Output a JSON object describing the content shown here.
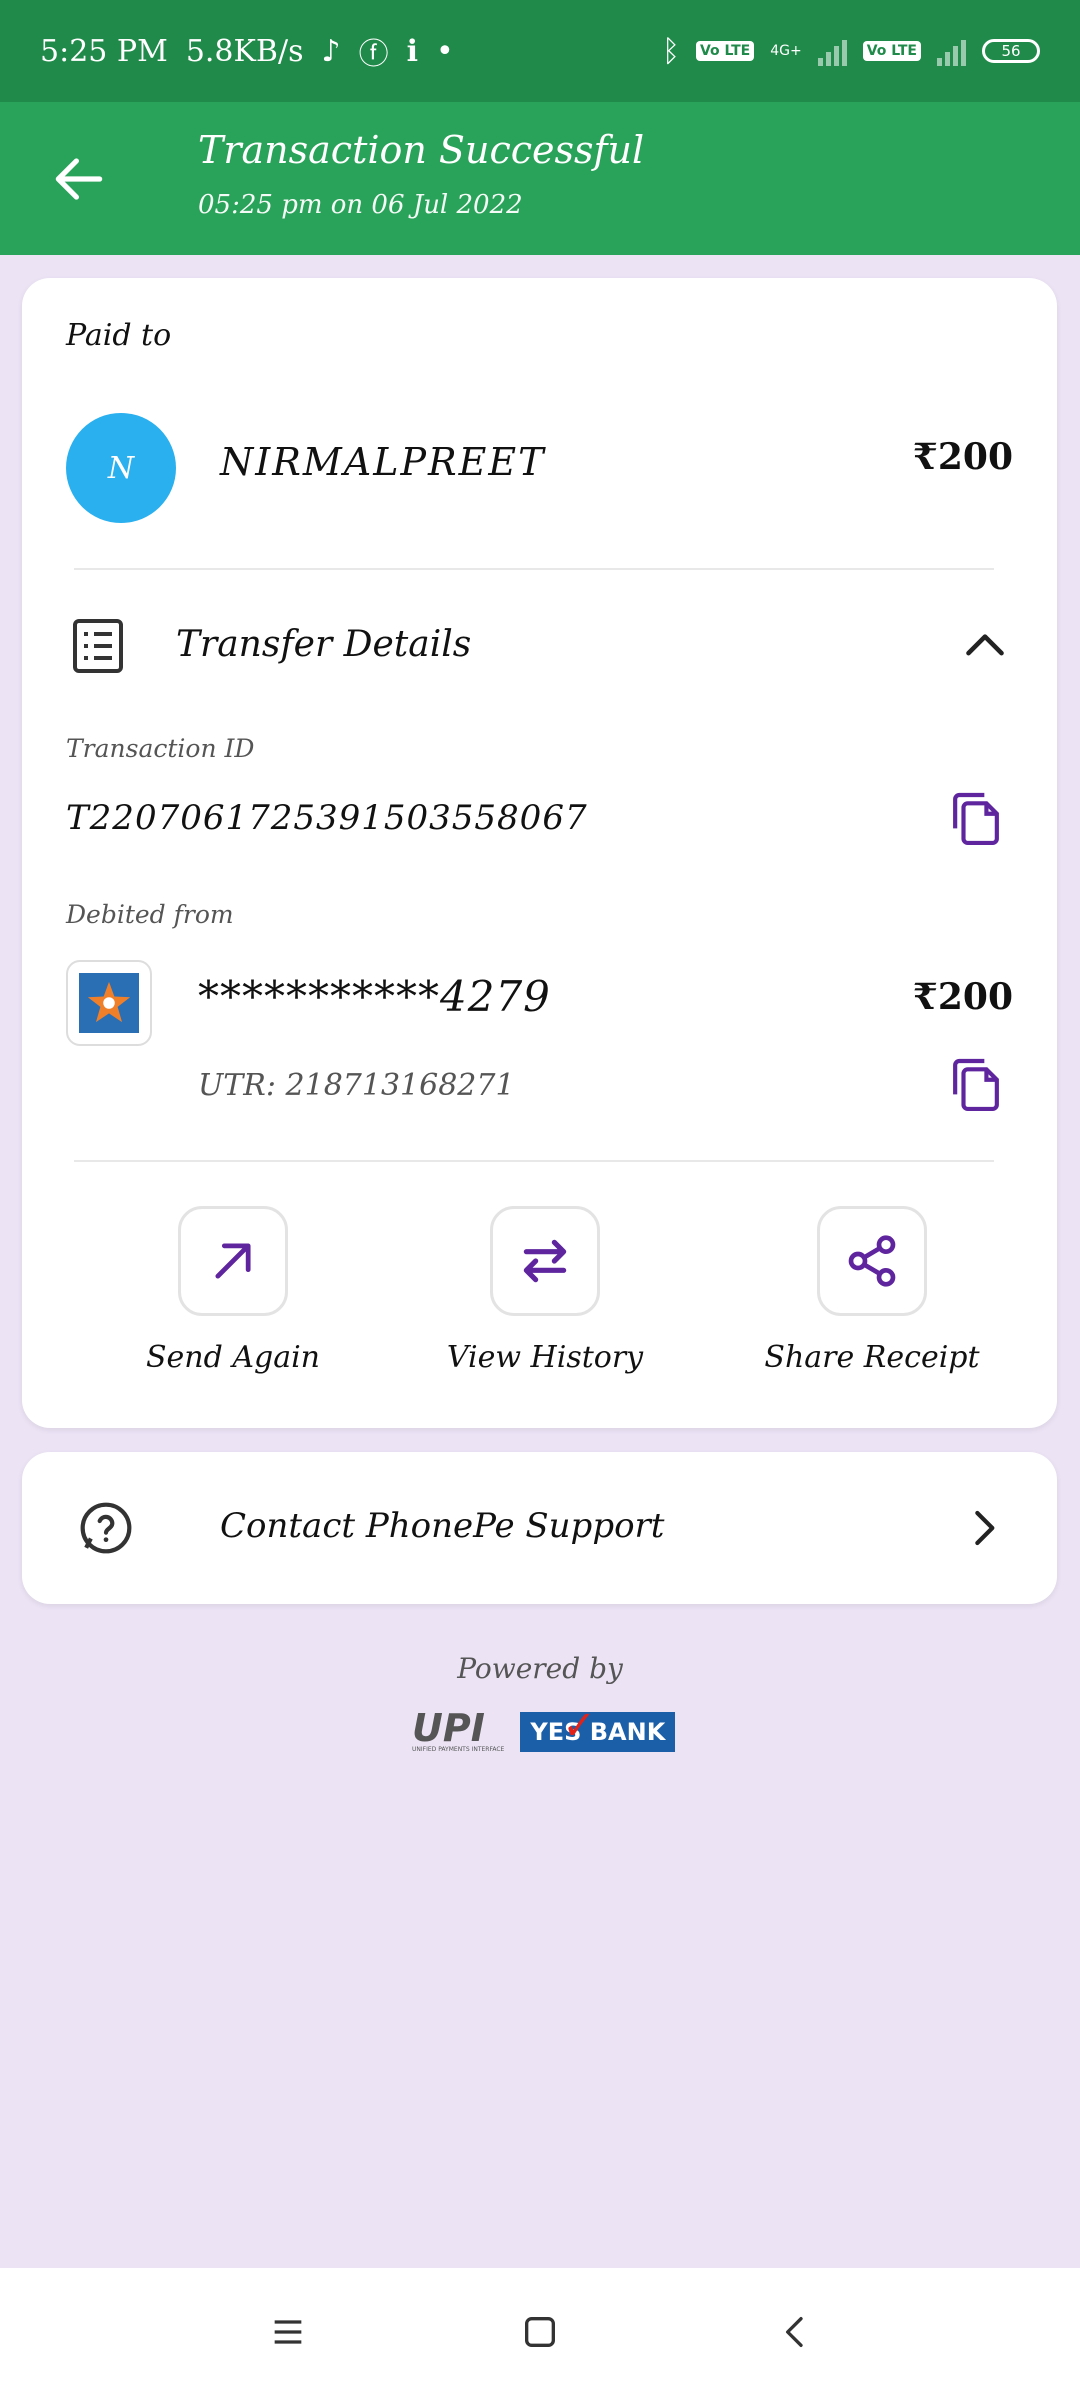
{
  "status_bar": {
    "time": "5:25 PM",
    "speed": "5.8KB/s",
    "network_text": "4G+",
    "volte1": "Vo LTE",
    "volte2": "Vo LTE",
    "battery": "56"
  },
  "header": {
    "title": "Transaction Successful",
    "subtitle": "05:25 pm on 06 Jul 2022"
  },
  "payment": {
    "paid_to_label": "Paid to",
    "avatar_letter": "N",
    "payee_name": "NIRMALPREET",
    "amount": "₹200"
  },
  "transfer_details": {
    "label": "Transfer Details",
    "transaction_id_label": "Transaction ID",
    "transaction_id": "T2207061725391503558067",
    "debited_from_label": "Debited from",
    "account": "***********4279",
    "amount": "₹200",
    "utr": "UTR: 218713168271"
  },
  "actions": [
    {
      "label": "Send Again",
      "icon": "arrow-up-right-icon"
    },
    {
      "label": "View History",
      "icon": "swap-arrows-icon"
    },
    {
      "label": "Share Receipt",
      "icon": "share-icon"
    }
  ],
  "support": {
    "label": "Contact PhonePe Support"
  },
  "footer": {
    "powered_by": "Powered by",
    "upi_logo": "UPI",
    "upi_sub": "UNIFIED PAYMENTS INTERFACE",
    "bank_logo": "YES BANK"
  },
  "colors": {
    "status_bar": "#1f8a49",
    "app_bar": "#2aa35a",
    "background": "#ece4f5",
    "accent": "#5f259f",
    "avatar": "#2ab0ef"
  }
}
